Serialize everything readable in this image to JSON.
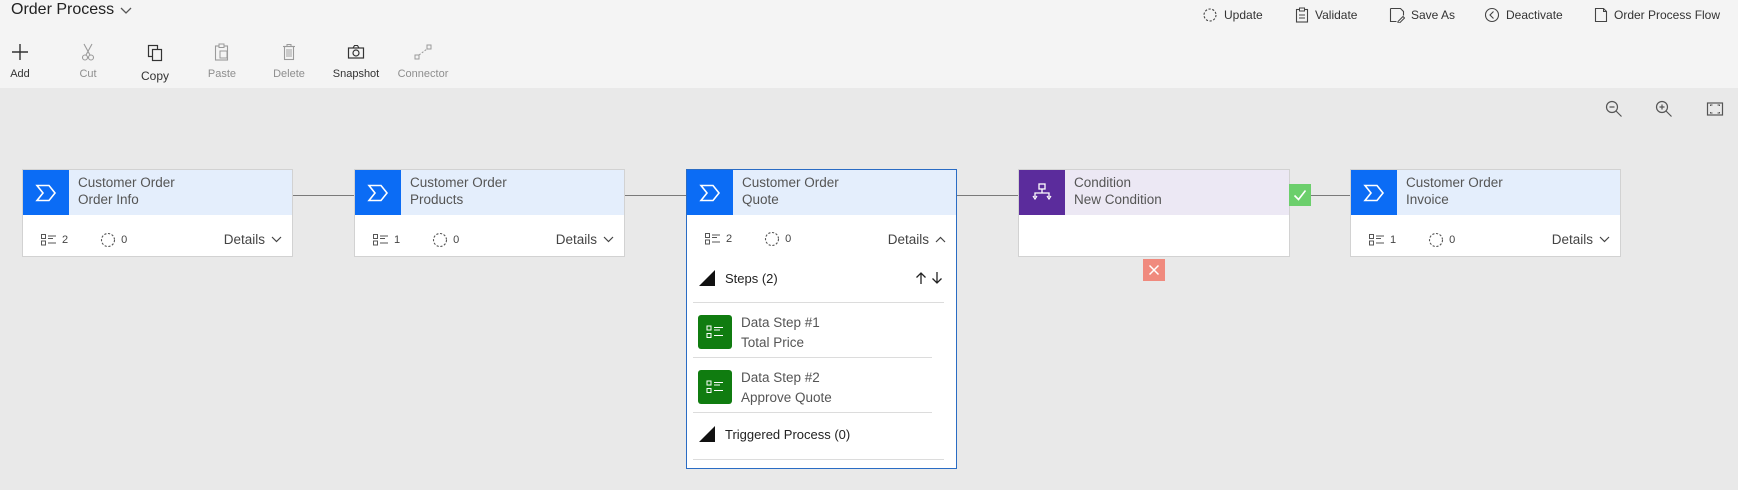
{
  "header": {
    "title": "Order Process",
    "commands": [
      {
        "label": "Update",
        "icon": "refresh-icon"
      },
      {
        "label": "Validate",
        "icon": "clipboard-icon"
      },
      {
        "label": "Save As",
        "icon": "save-as-icon"
      },
      {
        "label": "Deactivate",
        "icon": "back-circle-icon"
      },
      {
        "label": "Order Process Flow",
        "icon": "document-icon"
      }
    ]
  },
  "toolbar": {
    "add": "Add",
    "cut": "Cut",
    "copy": "Copy",
    "paste": "Paste",
    "delete": "Delete",
    "snapshot": "Snapshot",
    "connector": "Connector"
  },
  "stages": [
    {
      "line1": "Customer Order",
      "line2": "Order Info",
      "steps": "2",
      "triggers": "0",
      "details": "Details"
    },
    {
      "line1": "Customer Order",
      "line2": "Products",
      "steps": "1",
      "triggers": "0",
      "details": "Details"
    },
    {
      "line1": "Customer Order",
      "line2": "Quote",
      "steps": "2",
      "triggers": "0",
      "details": "Details"
    },
    {
      "line1": "Customer Order",
      "line2": "Invoice",
      "steps": "1",
      "triggers": "0",
      "details": "Details"
    }
  ],
  "condition": {
    "line1": "Condition",
    "line2": "New Condition"
  },
  "expanded": {
    "steps_label": "Steps (2)",
    "steps": [
      {
        "title": "Data Step #1",
        "subtitle": "Total Price"
      },
      {
        "title": "Data Step #2",
        "subtitle": "Approve Quote"
      }
    ],
    "triggered_label": "Triggered Process (0)"
  }
}
